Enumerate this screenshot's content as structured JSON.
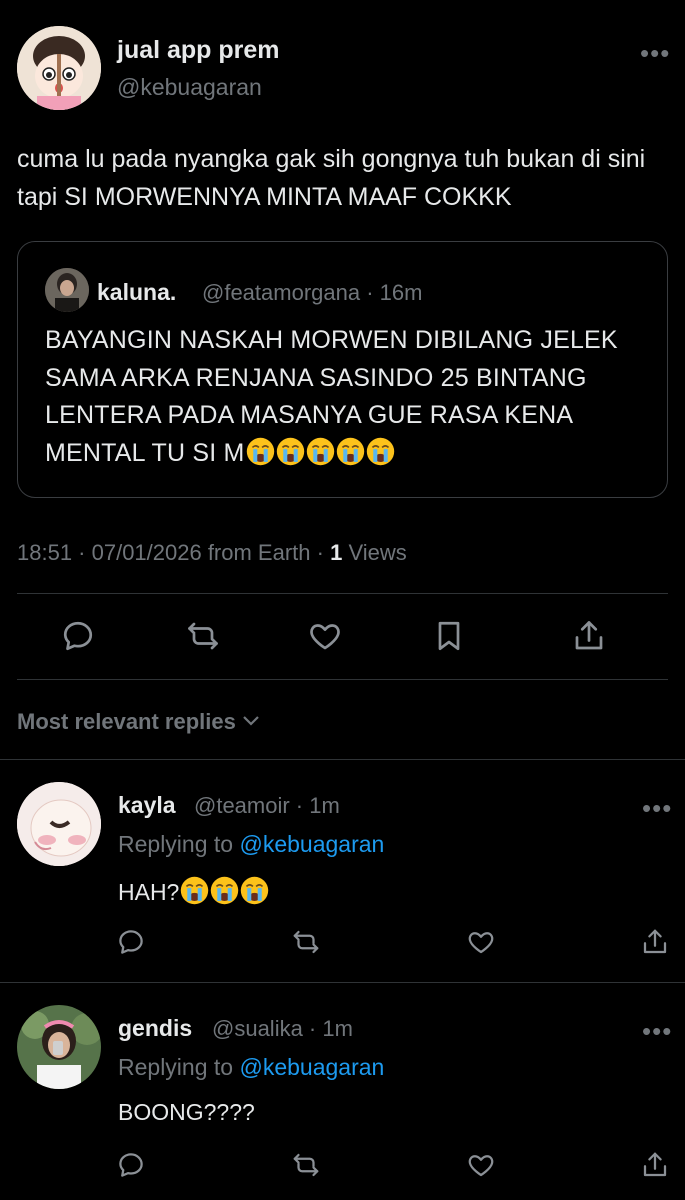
{
  "main_tweet": {
    "name": "jual app prem",
    "handle": "@kebuagaran",
    "text": "cuma lu pada nyangka gak sih gongnya tuh bukan di sini tapi SI MORWENNYA MINTA MAAF COKKK",
    "quote": {
      "name": "kaluna.",
      "handle_time": "@featamorgana · 16m",
      "text": "BAYANGIN NASKAH MORWEN DIBILANG JELEK SAMA ARKA RENJANA SASINDO 25 BINTANG LENTERA PADA MASANYA GUE RASA KENA MENTAL TU SI M",
      "emoji_count": 5
    },
    "meta_prefix": "18:51 · 07/01/2026 from Earth · ",
    "views_count": "1",
    "views_label": " Views"
  },
  "actions": {
    "icons": [
      "reply-icon",
      "retweet-icon",
      "like-icon",
      "bookmark-icon",
      "share-icon"
    ]
  },
  "sort": {
    "label": "Most relevant replies"
  },
  "replies": [
    {
      "name": "kayla",
      "handle_time": "@teamoir · 1m",
      "replying_prefix": "Replying to ",
      "replying_mention": "@kebuagaran",
      "text": "HAH?",
      "emoji_count": 3
    },
    {
      "name": "gendis",
      "handle_time": "@sualika · 1m",
      "replying_prefix": "Replying to ",
      "replying_mention": "@kebuagaran",
      "text": "BOONG????",
      "emoji_count": 0
    }
  ],
  "colors": {
    "background": "#000000",
    "text": "#e7e9ea",
    "muted": "#71767b",
    "link": "#1d9bf0",
    "border": "#2f3336"
  }
}
